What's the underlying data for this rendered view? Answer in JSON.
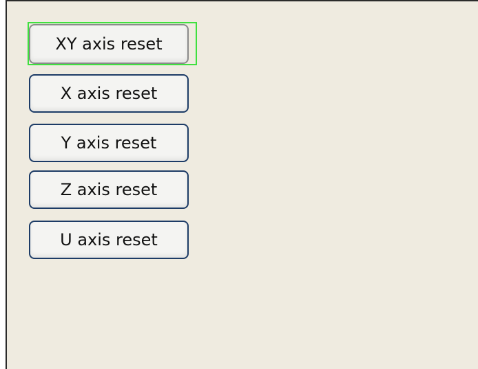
{
  "buttons": [
    {
      "label": "XY axis reset",
      "focused": true
    },
    {
      "label": "X axis reset",
      "focused": false
    },
    {
      "label": "Y axis reset",
      "focused": false
    },
    {
      "label": "Z axis reset",
      "focused": false
    },
    {
      "label": "U axis reset",
      "focused": false
    }
  ],
  "colors": {
    "panel_background": "#efebe0",
    "button_border": "#1c3b66",
    "focus_ring": "#3fe03f"
  }
}
